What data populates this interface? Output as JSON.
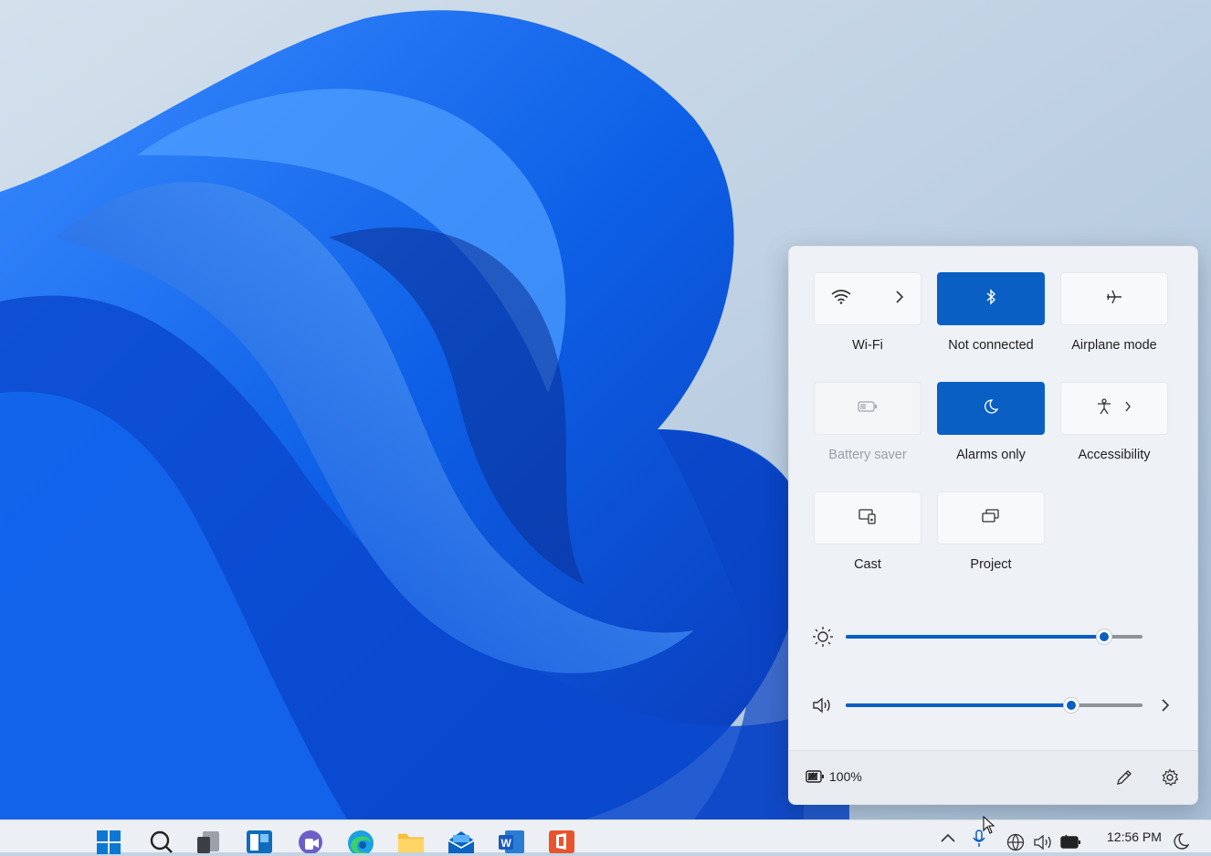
{
  "quick_settings": {
    "tiles": [
      {
        "label": "Wi-Fi",
        "icon": "wifi-icon",
        "active": false,
        "has_chevron": true
      },
      {
        "label": "Not connected",
        "icon": "bluetooth-icon",
        "active": true,
        "has_chevron": false
      },
      {
        "label": "Airplane mode",
        "icon": "airplane-icon",
        "active": false,
        "has_chevron": false
      },
      {
        "label": "Battery saver",
        "icon": "battery-saver-icon",
        "active": false,
        "disabled": true
      },
      {
        "label": "Alarms only",
        "icon": "moon-icon",
        "active": true,
        "has_chevron": false
      },
      {
        "label": "Accessibility",
        "icon": "accessibility-icon",
        "active": false,
        "has_chevron": true
      },
      {
        "label": "Cast",
        "icon": "cast-icon",
        "active": false
      },
      {
        "label": "Project",
        "icon": "project-icon",
        "active": false
      }
    ],
    "brightness": {
      "icon": "brightness-icon",
      "value_percent": 87
    },
    "volume": {
      "icon": "volume-icon",
      "value_percent": 76
    },
    "footer": {
      "battery_icon": "battery-charging-icon",
      "battery_text": "100%",
      "edit_icon": "pencil-icon",
      "settings_icon": "gear-icon"
    }
  },
  "taskbar": {
    "apps": [
      "start-icon",
      "search-icon",
      "task-view-icon",
      "widgets-icon",
      "teams-chat-icon",
      "edge-icon",
      "file-explorer-icon",
      "mail-icon",
      "word-icon",
      "office-icon"
    ],
    "tray_icons": [
      "show-hidden-icons-chevron",
      "microphone-icon",
      "language-icon",
      "speaker-icon",
      "battery-icon"
    ],
    "time": "12:56 PM",
    "focus_icon": "moon-icon"
  },
  "colors": {
    "accent": "#0a5fc4",
    "panel_bg": "#eef1f6",
    "taskbar_bg": "#eceff4"
  }
}
